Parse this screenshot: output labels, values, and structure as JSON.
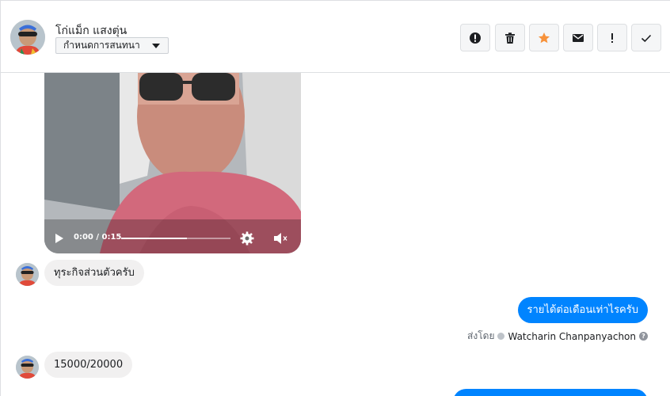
{
  "header": {
    "contact_name": "โก่แม็ก แสงตุ่น",
    "conversation_menu_label": "กำหนดการสนทนา",
    "toolbar": [
      {
        "icon": "alert-circle-icon"
      },
      {
        "icon": "trash-icon"
      },
      {
        "icon": "star-icon",
        "color": "#f7923b"
      },
      {
        "icon": "envelope-icon"
      },
      {
        "icon": "exclamation-icon"
      },
      {
        "icon": "checkmark-icon"
      }
    ]
  },
  "video": {
    "time": "0:00 / 0:15",
    "progress": 0.6,
    "icons": [
      "play-icon",
      "settings-gear-icon",
      "mute-icon"
    ]
  },
  "messages": [
    {
      "direction": "in",
      "text": "ทุระกิจส่วนตัวครับ"
    },
    {
      "direction": "out",
      "text": "รายได้ต่อเดือนเท่าไรครับ"
    },
    {
      "direction": "in",
      "text": "15000/20000"
    }
  ],
  "sent_by": {
    "prefix": "ส่งโดย",
    "sender": "Watcharin Chanpanyachon",
    "help": "?"
  },
  "colors": {
    "accent": "#0084ff",
    "incoming_bubble": "#f1f0f0",
    "star": "#f7923b"
  }
}
